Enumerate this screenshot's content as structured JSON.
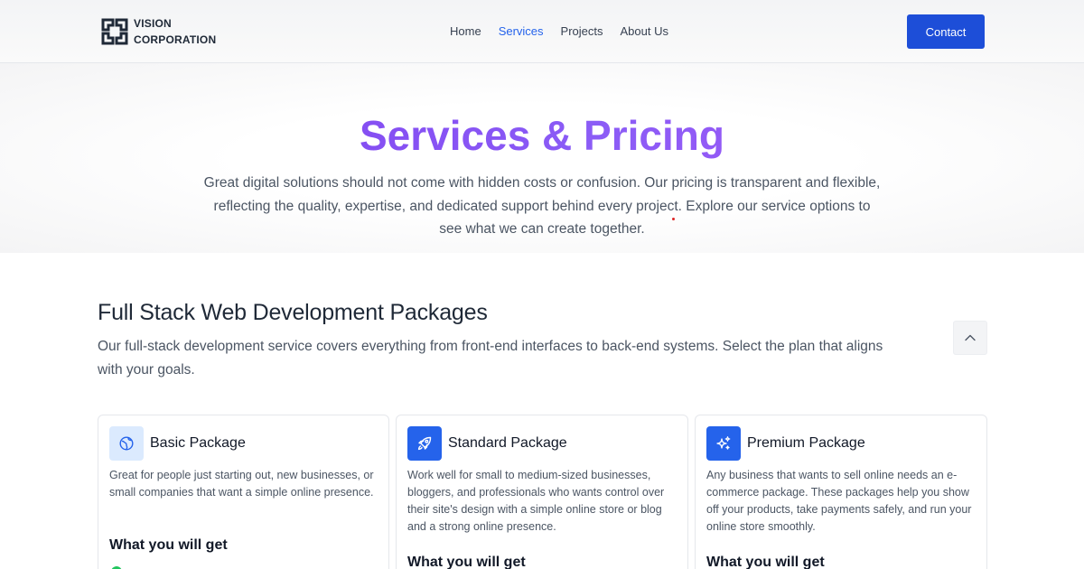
{
  "header": {
    "logo": {
      "line1": "VISION",
      "line2": "CORPORATION"
    },
    "nav": [
      {
        "label": "Home",
        "active": false
      },
      {
        "label": "Services",
        "active": true
      },
      {
        "label": "Projects",
        "active": false
      },
      {
        "label": "About Us",
        "active": false
      }
    ],
    "contact_label": "Contact"
  },
  "hero": {
    "title": "Services & Pricing",
    "description": "Great digital solutions should not come with hidden costs or confusion. Our pricing is transparent and flexible, reflecting the quality, expertise, and dedicated support behind every project. Explore our service options to see what we can create together."
  },
  "section": {
    "title": "Full Stack Web Development Packages",
    "description": "Our full-stack development service covers everything from front-end interfaces to back-end systems. Select the plan that aligns with your goals."
  },
  "packages": [
    {
      "name": "Basic Package",
      "icon": "globe-icon",
      "description": "Great for people just starting out, new businesses, or small companies that want a simple online presence.",
      "features_heading": "What you will get"
    },
    {
      "name": "Standard Package",
      "icon": "rocket-icon",
      "description": "Work well for small to medium-sized businesses, bloggers, and professionals who wants control over their site's design with a simple online store or blog and a strong online presence.",
      "features_heading": "What you will get"
    },
    {
      "name": "Premium Package",
      "icon": "sparkles-icon",
      "description": "Any business that wants to sell online needs an e-commerce package. These packages help you show off your products, take payments safely, and run your online store smoothly.",
      "features_heading": "What you will get"
    }
  ],
  "colors": {
    "accent": "#1d4ed8",
    "nav_active": "#2563eb",
    "title_gradient_start": "#7c3aed",
    "title_gradient_end": "#a855f7"
  }
}
